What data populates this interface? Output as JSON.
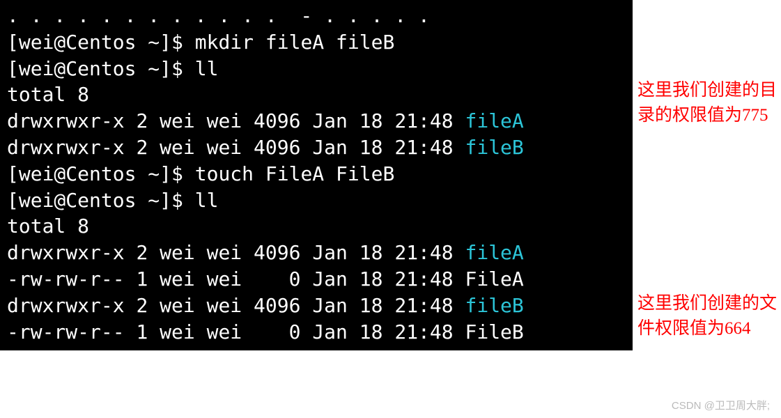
{
  "terminal": {
    "top_fragment": ". . . . . . . . . . . .  - . . . . .",
    "prompt": "[wei@Centos ~]$",
    "cmd_mkdir": "mkdir fileA fileB",
    "cmd_ll": "ll",
    "cmd_touch": "touch FileA FileB",
    "total_line": "total 8",
    "rows_first": [
      {
        "perm": "drwxrwxr-x",
        "links": "2",
        "owner": "wei",
        "group": "wei",
        "size": "4096",
        "date": "Jan 18 21:48",
        "name": "fileA",
        "is_dir": true
      },
      {
        "perm": "drwxrwxr-x",
        "links": "2",
        "owner": "wei",
        "group": "wei",
        "size": "4096",
        "date": "Jan 18 21:48",
        "name": "fileB",
        "is_dir": true
      }
    ],
    "rows_second": [
      {
        "perm": "drwxrwxr-x",
        "links": "2",
        "owner": "wei",
        "group": "wei",
        "size": "4096",
        "date": "Jan 18 21:48",
        "name": "fileA",
        "is_dir": true
      },
      {
        "perm": "-rw-rw-r--",
        "links": "1",
        "owner": "wei",
        "group": "wei",
        "size": "   0",
        "date": "Jan 18 21:48",
        "name": "FileA",
        "is_dir": false
      },
      {
        "perm": "drwxrwxr-x",
        "links": "2",
        "owner": "wei",
        "group": "wei",
        "size": "4096",
        "date": "Jan 18 21:48",
        "name": "fileB",
        "is_dir": true
      },
      {
        "perm": "-rw-rw-r--",
        "links": "1",
        "owner": "wei",
        "group": "wei",
        "size": "   0",
        "date": "Jan 18 21:48",
        "name": "FileB",
        "is_dir": false
      }
    ]
  },
  "annotations": {
    "a1": "这里我们创建的目录的权限值为775",
    "a2": "这里我们创建的文件权限值为664"
  },
  "watermark": "CSDN @卫卫周大胖;"
}
